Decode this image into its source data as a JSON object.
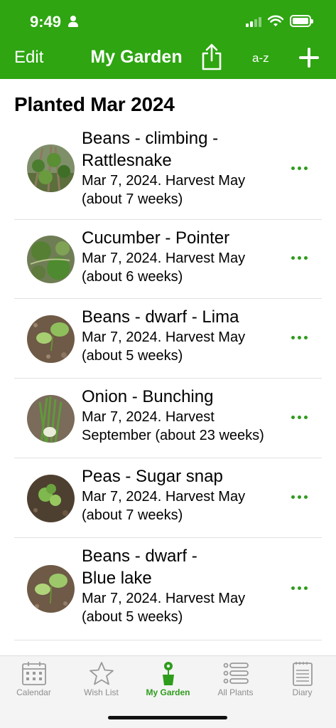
{
  "status_bar": {
    "time": "9:49"
  },
  "nav": {
    "edit_label": "Edit",
    "title": "My Garden",
    "share_icon": "share-icon",
    "sort_label": "a-z",
    "add_icon": "plus-icon"
  },
  "section": {
    "title": "Planted Mar 2024"
  },
  "plants": [
    {
      "name_line1": "Beans - climbing -",
      "name_line2": "Rattlesnake",
      "date_line1": "Mar 7, 2024. Harvest May",
      "date_line2": "(about 7 weeks)"
    },
    {
      "name_line1": "Cucumber - Pointer",
      "name_line2": "",
      "date_line1": "Mar 7, 2024. Harvest May",
      "date_line2": "(about 6 weeks)"
    },
    {
      "name_line1": "Beans - dwarf - Lima",
      "name_line2": "",
      "date_line1": "Mar 7, 2024. Harvest May",
      "date_line2": "(about 5 weeks)"
    },
    {
      "name_line1": "Onion - Bunching",
      "name_line2": "",
      "date_line1": "Mar 7, 2024. Harvest",
      "date_line2": "September (about 23 weeks)"
    },
    {
      "name_line1": "Peas - Sugar snap",
      "name_line2": "",
      "date_line1": "Mar 7, 2024. Harvest May",
      "date_line2": "(about 7 weeks)"
    },
    {
      "name_line1": "Beans - dwarf -",
      "name_line2": "Blue lake",
      "date_line1": "Mar 7, 2024. Harvest May",
      "date_line2": "(about 5 weeks)"
    }
  ],
  "tabs": [
    {
      "label": "Calendar",
      "icon": "calendar-icon"
    },
    {
      "label": "Wish List",
      "icon": "star-icon"
    },
    {
      "label": "My Garden",
      "icon": "potted-plant-icon"
    },
    {
      "label": "All Plants",
      "icon": "list-icon"
    },
    {
      "label": "Diary",
      "icon": "notebook-icon"
    }
  ],
  "colors": {
    "brand_green": "#2ea511",
    "accent_green": "#2e9c1c",
    "inactive_gray": "#8e8e8e"
  }
}
